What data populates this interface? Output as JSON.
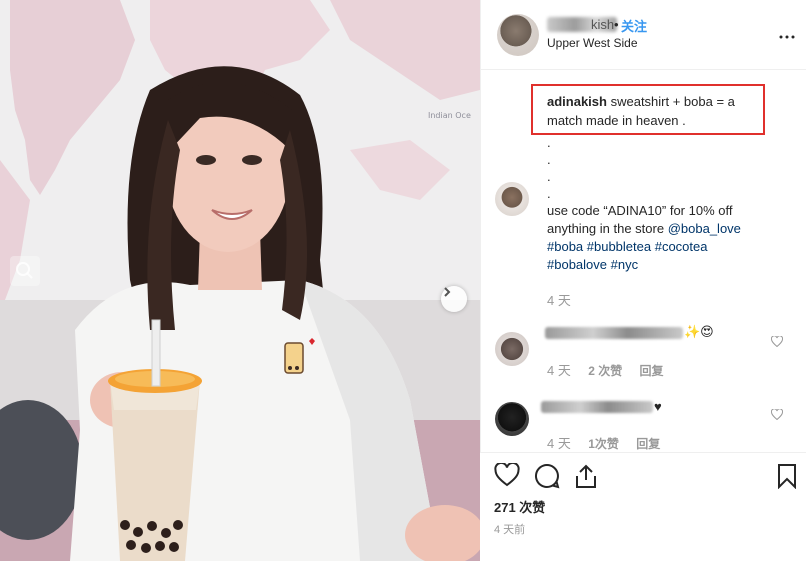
{
  "post": {
    "username_visible_tail": "kish",
    "follow_separator": "•",
    "follow_label": "关注",
    "location": "Upper West Side"
  },
  "caption": {
    "author": "adinakish",
    "text": "sweatshirt + boba = a match made in heaven ."
  },
  "comments": [
    {
      "dots": [
        ".",
        ".",
        ".",
        "."
      ],
      "line1": "use code “ADINA10” for 10% off",
      "line2_prefix": "anything in the store ",
      "mention": "@boba_love",
      "tags_line1": "#boba #bubbletea #cocotea",
      "tags_line2": "#bobalove #nyc",
      "time": "4 天"
    },
    {
      "name_visible_tail": "a  ole",
      "emoji": "✨😍",
      "time": "4 天",
      "likes": "2 次赞",
      "reply": "回复"
    },
    {
      "emoji": "♥",
      "time": "4 天",
      "likes": "1次赞",
      "reply": "回复"
    }
  ],
  "footer": {
    "likes": "271 次赞",
    "posted": "4 天前"
  },
  "icons": {
    "like": "heart-icon",
    "comment": "comment-icon",
    "share": "share-icon",
    "save": "bookmark-icon",
    "next": "chevron-right-icon",
    "zoom": "magnifier-icon"
  },
  "colors": {
    "follow": "#3897f0",
    "highlight_border": "#e0302c",
    "hashtag": "#003569",
    "muted": "#999999"
  }
}
